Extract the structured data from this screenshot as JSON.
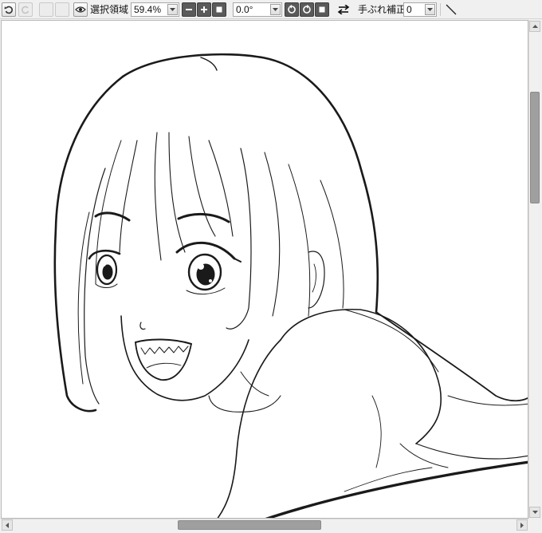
{
  "toolbar": {
    "undo_icon": "undo-icon",
    "redo_icon": "redo-icon",
    "selection_icon": "eye-icon",
    "selection_label": "選択領域",
    "zoom_value": "59.4%",
    "zoom_out_icon": "minus-icon",
    "zoom_in_icon": "plus-icon",
    "zoom_fit_icon": "square-icon",
    "rotation_value": "0.0°",
    "rotate_ccw_icon": "rotate-left-icon",
    "rotate_cw_icon": "rotate-right-icon",
    "rotate_reset_icon": "square-icon",
    "flip_icon": "flip-horizontal-icon",
    "stabilizer_label": "手ぶれ補正",
    "stabilizer_value": "0",
    "line_tool_icon": "line-icon"
  },
  "colors": {
    "toolbar_bg": "#f0f0f0",
    "canvas_bg": "#ffffff",
    "line_art": "#1a1a1a",
    "scroll_thumb": "#9f9f9f"
  }
}
